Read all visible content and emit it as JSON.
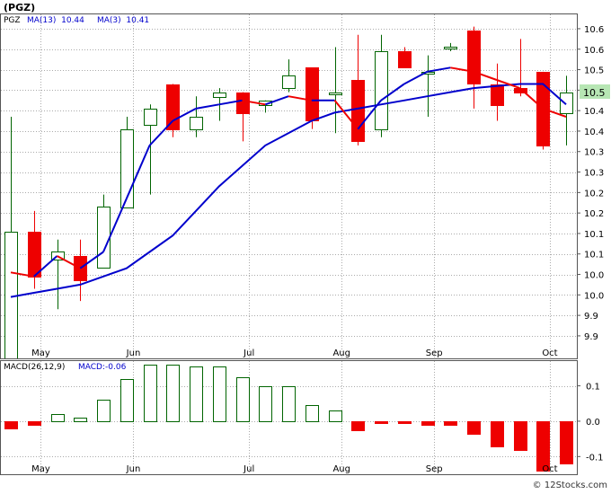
{
  "header": {
    "title": "(PGZ)",
    "legend": [
      {
        "label": "PGZ",
        "color": "#000000"
      },
      {
        "label": "MA(13)  10.44",
        "color": "#0000cc"
      },
      {
        "label": "MA(3)  10.41",
        "color": "#0000cc"
      }
    ]
  },
  "macd_header": {
    "legend": [
      {
        "label": "MACD(26,12,9)",
        "color": "#000000"
      },
      {
        "label": "MACD:-0.06",
        "color": "#0000cc"
      }
    ]
  },
  "price_badge": "10.5",
  "watermark": "© 12Stocks.com",
  "colors": {
    "up": "#006400",
    "down": "#ee0000",
    "ma13": "#0000cc",
    "grid": "#aaaaaa",
    "badge": "#b7e6b4"
  },
  "chart_data": [
    {
      "type": "candlestick",
      "title": "(PGZ)",
      "x_ticks": [
        {
          "index": 1.3,
          "label": "May"
        },
        {
          "index": 5.3,
          "label": "Jun"
        },
        {
          "index": 10.3,
          "label": "Jul"
        },
        {
          "index": 14.3,
          "label": "Aug"
        },
        {
          "index": 18.3,
          "label": "Sep"
        },
        {
          "index": 23.3,
          "label": "Oct"
        }
      ],
      "ylim": [
        9.82,
        10.66
      ],
      "y_ticks": [
        {
          "value": 10.625,
          "label": "10.6"
        },
        {
          "value": 10.575,
          "label": "10.6"
        },
        {
          "value": 10.525,
          "label": "10.5"
        },
        {
          "value": 10.475,
          "label": "10.5"
        },
        {
          "value": 10.425,
          "label": "10.4"
        },
        {
          "value": 10.375,
          "label": "10.4"
        },
        {
          "value": 10.325,
          "label": "10.3"
        },
        {
          "value": 10.275,
          "label": "10.3"
        },
        {
          "value": 10.225,
          "label": "10.2"
        },
        {
          "value": 10.175,
          "label": "10.2"
        },
        {
          "value": 10.125,
          "label": "10.1"
        },
        {
          "value": 10.075,
          "label": "10.1"
        },
        {
          "value": 10.025,
          "label": "10.0"
        },
        {
          "value": 9.975,
          "label": "10.0"
        },
        {
          "value": 9.925,
          "label": "9.9"
        },
        {
          "value": 9.875,
          "label": "9.9"
        }
      ],
      "grid": true,
      "candles": [
        {
          "o": 9.82,
          "h": 10.41,
          "l": 9.82,
          "c": 10.13
        },
        {
          "o": 10.13,
          "h": 10.18,
          "l": 9.99,
          "c": 10.02
        },
        {
          "o": 10.06,
          "h": 10.11,
          "l": 9.94,
          "c": 10.08
        },
        {
          "o": 10.07,
          "h": 10.11,
          "l": 9.96,
          "c": 10.01
        },
        {
          "o": 10.04,
          "h": 10.22,
          "l": 10.04,
          "c": 10.19
        },
        {
          "o": 10.19,
          "h": 10.41,
          "l": 10.19,
          "c": 10.38
        },
        {
          "o": 10.39,
          "h": 10.44,
          "l": 10.22,
          "c": 10.43
        },
        {
          "o": 10.49,
          "h": 10.49,
          "l": 10.36,
          "c": 10.38
        },
        {
          "o": 10.38,
          "h": 10.46,
          "l": 10.36,
          "c": 10.41
        },
        {
          "o": 10.46,
          "h": 10.48,
          "l": 10.4,
          "c": 10.47
        },
        {
          "o": 10.47,
          "h": 10.47,
          "l": 10.35,
          "c": 10.42
        },
        {
          "o": 10.44,
          "h": 10.45,
          "l": 10.42,
          "c": 10.45
        },
        {
          "o": 10.48,
          "h": 10.55,
          "l": 10.47,
          "c": 10.51
        },
        {
          "o": 10.53,
          "h": 10.53,
          "l": 10.38,
          "c": 10.4
        },
        {
          "o": 10.47,
          "h": 10.58,
          "l": 10.37,
          "c": 10.47
        },
        {
          "o": 10.5,
          "h": 10.61,
          "l": 10.34,
          "c": 10.35
        },
        {
          "o": 10.38,
          "h": 10.61,
          "l": 10.36,
          "c": 10.57
        },
        {
          "o": 10.57,
          "h": 10.58,
          "l": 10.53,
          "c": 10.53
        },
        {
          "o": 10.52,
          "h": 10.56,
          "l": 10.41,
          "c": 10.52
        },
        {
          "o": 10.58,
          "h": 10.59,
          "l": 10.57,
          "c": 10.58
        },
        {
          "o": 10.62,
          "h": 10.63,
          "l": 10.43,
          "c": 10.49
        },
        {
          "o": 10.49,
          "h": 10.54,
          "l": 10.4,
          "c": 10.44
        },
        {
          "o": 10.48,
          "h": 10.6,
          "l": 10.46,
          "c": 10.47
        },
        {
          "o": 10.52,
          "h": 10.52,
          "l": 10.33,
          "c": 10.34
        },
        {
          "o": 10.42,
          "h": 10.51,
          "l": 10.34,
          "c": 10.47
        }
      ],
      "series": [
        {
          "label": "MA(13)",
          "values": [
            9.97,
            9.98,
            9.99,
            10.0,
            10.02,
            10.04,
            10.08,
            10.12,
            10.18,
            10.24,
            10.29,
            10.34,
            10.37,
            10.4,
            10.42,
            10.43,
            10.44,
            10.45,
            10.46,
            10.47,
            10.48,
            10.485,
            10.49,
            10.49,
            10.44
          ]
        },
        {
          "label": "MA(3)",
          "values": [
            10.03,
            10.02,
            10.07,
            10.04,
            10.08,
            10.21,
            10.34,
            10.4,
            10.43,
            10.44,
            10.45,
            10.44,
            10.46,
            10.45,
            10.45,
            10.38,
            10.45,
            10.49,
            10.52,
            10.53,
            10.52,
            10.5,
            10.48,
            10.43,
            10.41
          ]
        }
      ]
    },
    {
      "type": "bar",
      "title": "MACD(26,12,9)",
      "categories": [
        "1",
        "2",
        "3",
        "4",
        "5",
        "6",
        "7",
        "8",
        "9",
        "10",
        "11",
        "12",
        "13",
        "14",
        "15",
        "16",
        "17",
        "18",
        "19",
        "20",
        "21",
        "22",
        "23",
        "24",
        "25"
      ],
      "values": [
        -0.02,
        -0.01,
        0.02,
        0.01,
        0.06,
        0.12,
        0.16,
        0.16,
        0.155,
        0.155,
        0.125,
        0.1,
        0.1,
        0.045,
        0.03,
        -0.025,
        -0.005,
        -0.005,
        -0.01,
        -0.01,
        -0.035,
        -0.07,
        -0.08,
        -0.14,
        -0.12
      ],
      "ylim": [
        -0.15,
        0.17
      ],
      "y_ticks": [
        {
          "value": 0.1,
          "label": "0.1"
        },
        {
          "value": 0.0,
          "label": "0.0"
        },
        {
          "value": -0.1,
          "label": "-0.1"
        }
      ],
      "x_ticks": [
        {
          "index": 1.3,
          "label": "May"
        },
        {
          "index": 5.3,
          "label": "Jun"
        },
        {
          "index": 10.3,
          "label": "Jul"
        },
        {
          "index": 14.3,
          "label": "Aug"
        },
        {
          "index": 18.3,
          "label": "Sep"
        },
        {
          "index": 23.3,
          "label": "Oct"
        }
      ],
      "grid": true
    }
  ]
}
